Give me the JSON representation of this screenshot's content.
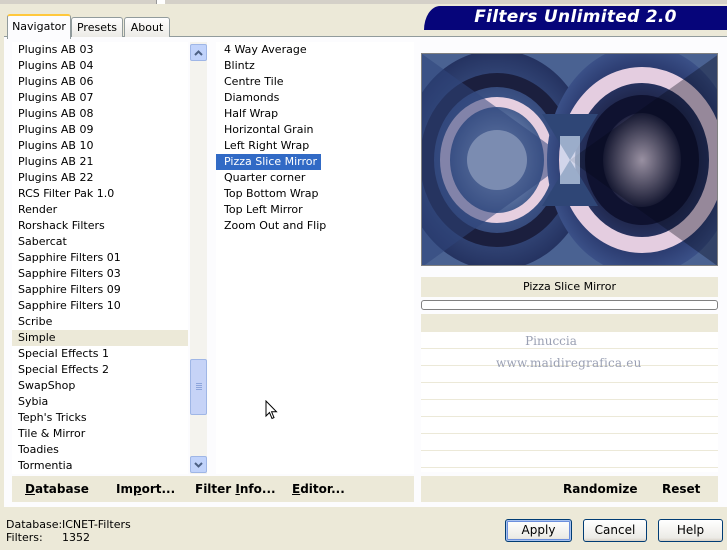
{
  "window": {
    "banner_title": "Filters Unlimited 2.0"
  },
  "tabs": [
    {
      "label": "Navigator",
      "active": true
    },
    {
      "label": "Presets",
      "active": false
    },
    {
      "label": "About",
      "active": false
    }
  ],
  "categories": {
    "items": [
      "Plugins AB 03",
      "Plugins AB 04",
      "Plugins AB 06",
      "Plugins AB 07",
      "Plugins AB 08",
      "Plugins AB 09",
      "Plugins AB 10",
      "Plugins AB 21",
      "Plugins AB 22",
      "RCS Filter Pak 1.0",
      "Render",
      "Rorshack Filters",
      "Sabercat",
      "Sapphire Filters 01",
      "Sapphire Filters 03",
      "Sapphire Filters 09",
      "Sapphire Filters 10",
      "Scribe",
      "Simple",
      "Special Effects 1",
      "Special Effects 2",
      "SwapShop",
      "Sybia",
      "Teph's Tricks",
      "Tile & Mirror",
      "Toadies",
      "Tormentia"
    ],
    "selected": "Simple"
  },
  "filters": {
    "items": [
      "4 Way Average",
      "Blintz",
      "Centre Tile",
      "Diamonds",
      "Half Wrap",
      "Horizontal Grain",
      "Left Right Wrap",
      "Pizza Slice Mirror",
      "Quarter corner",
      "Top Bottom Wrap",
      "Top Left Mirror",
      "Zoom Out and Flip"
    ],
    "selected": "Pizza Slice Mirror"
  },
  "preview": {
    "filter_name": "Pizza Slice Mirror",
    "watermark_line1": "Pinuccia",
    "watermark_line2": "www.maidiregrafica.eu"
  },
  "toolbar": {
    "database": {
      "first": "D",
      "rest": "atabase"
    },
    "import": {
      "first": "I",
      "mid": "m",
      "u": "p",
      "rest": "ort..."
    },
    "filter_info": {
      "text": "Filter ",
      "u": "I",
      "rest": "nfo..."
    },
    "editor": {
      "u": "E",
      "rest": "ditor..."
    },
    "randomize": "Randomize",
    "reset": "Reset"
  },
  "status": {
    "database_label": "Database:",
    "database_value": "ICNET-Filters",
    "filters_label": "Filters:",
    "filters_value": "1352"
  },
  "buttons": {
    "apply": "Apply",
    "cancel": "Cancel",
    "help": "Help"
  },
  "colors": {
    "banner": "#06057a",
    "selection": "#316ac5",
    "panel": "#ece9d8"
  }
}
